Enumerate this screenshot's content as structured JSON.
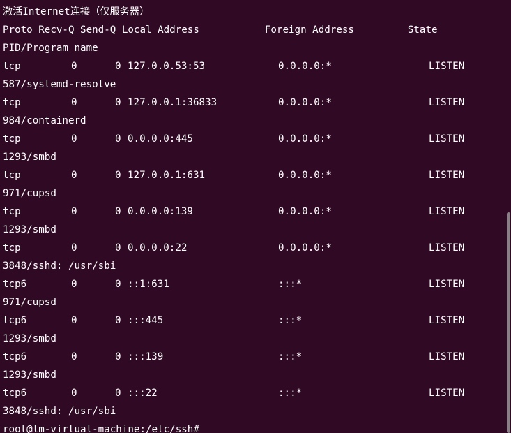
{
  "terminal": {
    "heading": "激活Internet连接（仅服务器）",
    "columns_header": "Proto Recv-Q Send-Q Local Address           Foreign Address         State",
    "columns_header_wrap": "PID/Program name",
    "rows": [
      {
        "proto": "tcp",
        "recvq": "0",
        "sendq": "0",
        "local": "127.0.0.53:53",
        "foreign": "0.0.0.0:*",
        "state": "LISTEN",
        "program": "587/systemd-resolve"
      },
      {
        "proto": "tcp",
        "recvq": "0",
        "sendq": "0",
        "local": "127.0.0.1:36833",
        "foreign": "0.0.0.0:*",
        "state": "LISTEN",
        "program": "984/containerd"
      },
      {
        "proto": "tcp",
        "recvq": "0",
        "sendq": "0",
        "local": "0.0.0.0:445",
        "foreign": "0.0.0.0:*",
        "state": "LISTEN",
        "program": "1293/smbd"
      },
      {
        "proto": "tcp",
        "recvq": "0",
        "sendq": "0",
        "local": "127.0.0.1:631",
        "foreign": "0.0.0.0:*",
        "state": "LISTEN",
        "program": "971/cupsd"
      },
      {
        "proto": "tcp",
        "recvq": "0",
        "sendq": "0",
        "local": "0.0.0.0:139",
        "foreign": "0.0.0.0:*",
        "state": "LISTEN",
        "program": "1293/smbd"
      },
      {
        "proto": "tcp",
        "recvq": "0",
        "sendq": "0",
        "local": "0.0.0.0:22",
        "foreign": "0.0.0.0:*",
        "state": "LISTEN",
        "program": "3848/sshd: /usr/sbi"
      },
      {
        "proto": "tcp6",
        "recvq": "0",
        "sendq": "0",
        "local": "::1:631",
        "foreign": ":::*",
        "state": "LISTEN",
        "program": "971/cupsd"
      },
      {
        "proto": "tcp6",
        "recvq": "0",
        "sendq": "0",
        "local": ":::445",
        "foreign": ":::*",
        "state": "LISTEN",
        "program": "1293/smbd"
      },
      {
        "proto": "tcp6",
        "recvq": "0",
        "sendq": "0",
        "local": ":::139",
        "foreign": ":::*",
        "state": "LISTEN",
        "program": "1293/smbd"
      },
      {
        "proto": "tcp6",
        "recvq": "0",
        "sendq": "0",
        "local": ":::22",
        "foreign": ":::*",
        "state": "LISTEN",
        "program": "3848/sshd: /usr/sbi"
      }
    ],
    "prompt": "root@lm-virtual-machine:/etc/ssh#",
    "colors": {
      "background": "#300a24",
      "text": "#ffffff",
      "scrollbar": "#8a7f86"
    }
  }
}
